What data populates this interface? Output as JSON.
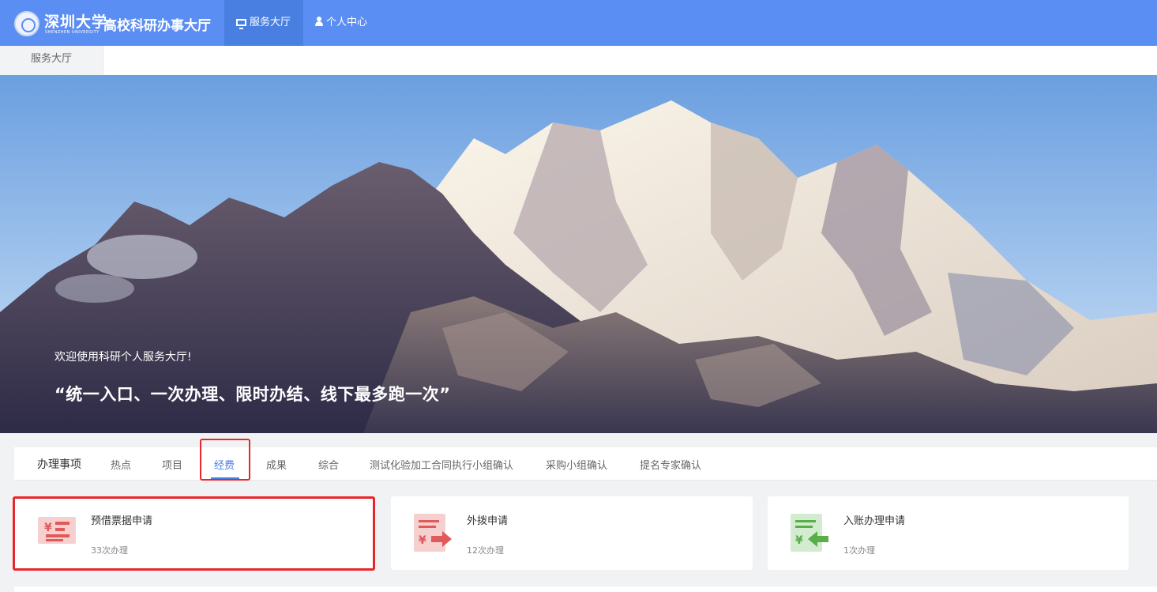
{
  "header": {
    "school_name": "深圳大学",
    "school_name_en": "SHENZHEN UNIVERSITY",
    "site_title": "高校科研办事大厅",
    "nav": [
      {
        "label": "服务大厅",
        "icon": "monitor-icon",
        "active": true
      },
      {
        "label": "个人中心",
        "icon": "user-icon",
        "active": false
      }
    ]
  },
  "tabbar": {
    "current_tab": "服务大厅"
  },
  "banner": {
    "welcome": "欢迎使用科研个人服务大厅!",
    "slogan": "“统一入口、一次办理、限时办结、线下最多跑一次”"
  },
  "categories": {
    "title": "办理事项",
    "items": [
      "热点",
      "项目",
      "经费",
      "成果",
      "综合",
      "测试化验加工合同执行小组确认",
      "采购小组确认",
      "提名专家确认"
    ],
    "active": "经费"
  },
  "cards": [
    {
      "title": "预借票据申请",
      "count": "33次办理",
      "icon": "receipt-icon"
    },
    {
      "title": "外拨申请",
      "count": "12次办理",
      "icon": "transfer-out-icon"
    },
    {
      "title": "入账办理申请",
      "count": "1次办理",
      "icon": "deposit-in-icon"
    }
  ],
  "colors": {
    "header_bg": "#5b8ef3",
    "active_accent": "#4a7fe2",
    "highlight": "#e8262c",
    "icon_red": "#e05a5a",
    "icon_green": "#5aae4a"
  }
}
